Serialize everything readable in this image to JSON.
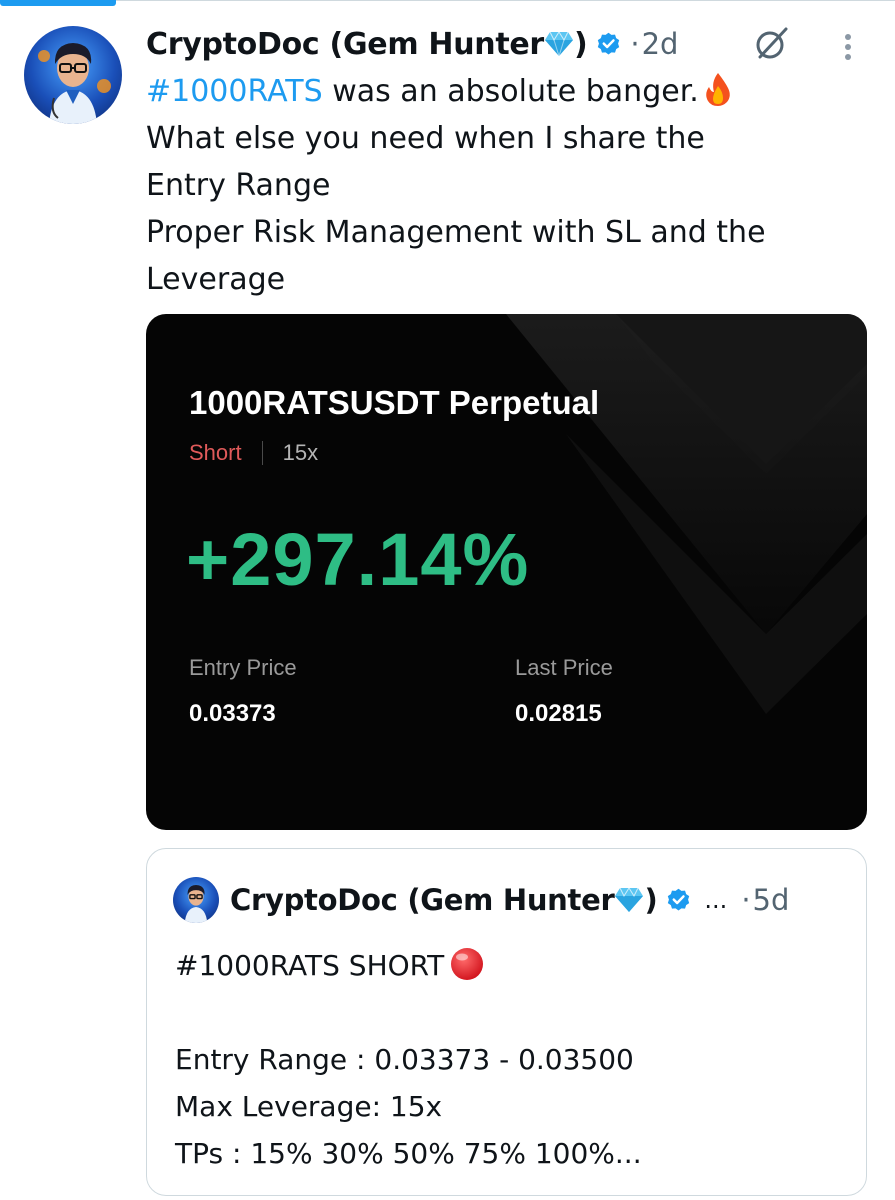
{
  "post": {
    "author_name": "CryptoDoc (Gem Hunter",
    "author_name_close": ")",
    "separator": "·",
    "time": "2d",
    "text": {
      "hashtag": "#1000RATS",
      "line1_rest": " was an absolute banger.",
      "line2": "What else you need when I share the",
      "line3": "Entry Range",
      "line4": "Proper Risk Management with SL and the",
      "line5": "Leverage"
    }
  },
  "trade_card": {
    "pair": "1000RATSUSDT Perpetual",
    "side": "Short",
    "leverage": "15x",
    "pnl_percent": "+297.14%",
    "entry_price_label": "Entry Price",
    "entry_price": "0.03373",
    "last_price_label": "Last Price",
    "last_price": "0.02815",
    "colors": {
      "positive": "#2ebd85",
      "short": "#e05a5a",
      "background": "#050505"
    }
  },
  "quoted_post": {
    "author_name": "CryptoDoc (Gem Hunter",
    "author_name_close": ")",
    "ellipsis": "...",
    "separator": "·",
    "time": "5d",
    "line1": "#1000RATS SHORT",
    "line2": "",
    "line3": "Entry Range : 0.03373 - 0.03500",
    "line4": "Max Leverage: 15x",
    "line5": "TPs : 15% 30% 50% 75% 100%..."
  },
  "icons": {
    "verified": "verified-badge-icon",
    "gem": "gem-emoji-icon",
    "fire": "fire-emoji-icon",
    "grok": "grok-icon",
    "more": "more-options-icon",
    "red_circle": "red-circle-emoji-icon"
  },
  "colors": {
    "accent": "#1d9bf0",
    "text": "#0f1419",
    "muted": "#536471",
    "border": "#cfd9de"
  }
}
